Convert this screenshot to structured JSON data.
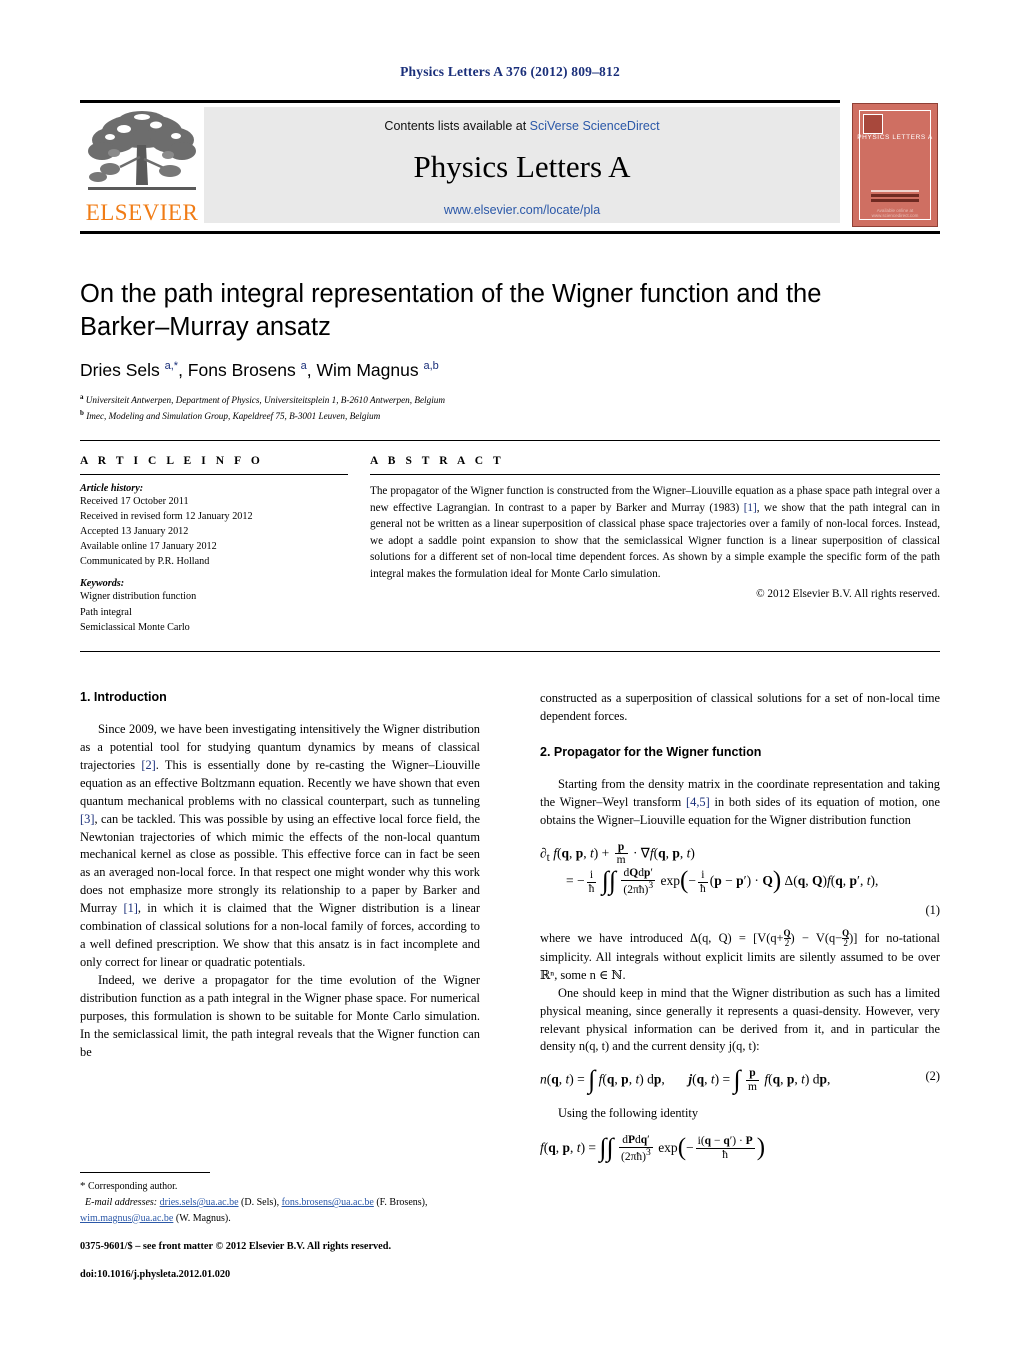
{
  "running_head": "Physics Letters A 376 (2012) 809–812",
  "masthead": {
    "contents_prefix": "Contents lists available at ",
    "contents_link": "SciVerse ScienceDirect",
    "journal_title": "Physics Letters A",
    "journal_url": "www.elsevier.com/locate/pla",
    "publisher_wordmark": "ELSEVIER",
    "cover_title": "PHYSICS LETTERS A",
    "cover_footer": "Available online at www.sciencedirect.com",
    "colors": {
      "link": "#2b58a8",
      "banner_bg": "#e9e9e9",
      "elsevier_orange": "#f07c16",
      "cover_red": "#cf6f62"
    }
  },
  "article": {
    "title": "On the path integral representation of the Wigner function and the Barker–Murray ansatz",
    "authors_html": "Dries Sels <sup>a,*</sup>, Fons Brosens <sup>a</sup>, Wim Magnus <sup>a,b</sup>",
    "affiliations": [
      {
        "marker": "a",
        "text": "Universiteit Antwerpen, Department of Physics, Universiteitsplein 1, B-2610 Antwerpen, Belgium"
      },
      {
        "marker": "b",
        "text": "Imec, Modeling and Simulation Group, Kapeldreef 75, B-3001 Leuven, Belgium"
      }
    ]
  },
  "article_info": {
    "heading": "A R T I C L E   I N F O",
    "history_label": "Article history:",
    "history": [
      "Received 17 October 2011",
      "Received in revised form 12 January 2012",
      "Accepted 13 January 2012",
      "Available online 17 January 2012",
      "Communicated by P.R. Holland"
    ],
    "keywords_label": "Keywords:",
    "keywords": [
      "Wigner distribution function",
      "Path integral",
      "Semiclassical Monte Carlo"
    ]
  },
  "abstract": {
    "heading": "A B S T R A C T",
    "part1": "The propagator of the Wigner function is constructed from the Wigner–Liouville equation as a phase space path integral over a new effective Lagrangian. In contrast to a paper by Barker and Murray (1983) ",
    "ref1": "[1]",
    "part2": ", we show that the path integral can in general not be written as a linear superposition of classical phase space trajectories over a family of non-local forces. Instead, we adopt a saddle point expansion to show that the semiclassical Wigner function is a linear superposition of classical solutions for a different set of non-local time dependent forces. As shown by a simple example the specific form of the path integral makes the formulation ideal for Monte Carlo simulation.",
    "copyright": "© 2012 Elsevier B.V. All rights reserved."
  },
  "sections": {
    "intro_heading": "1. Introduction",
    "intro_p1_a": "Since 2009, we have been investigating intensitively the Wigner distribution as a potential tool for studying quantum dynamics by means of classical trajectories ",
    "intro_p1_ref1": "[2]",
    "intro_p1_b": ". This is essentially done by re-casting the Wigner–Liouville equation as an effective Boltzmann equation. Recently we have shown that even quantum mechanical problems with no classical counterpart, such as tunneling ",
    "intro_p1_ref2": "[3]",
    "intro_p1_c": ", can be tackled. This was possible by using an effective local force field, the Newtonian trajectories of which mimic the effects of the non-local quantum mechanical kernel as close as possible. This effective force can in fact be seen as an averaged non-local force. In that respect one might wonder why this work does not emphasize more strongly its relationship to a paper by Barker and Murray ",
    "intro_p1_ref3": "[1]",
    "intro_p1_d": ", in which it is claimed that the Wigner distribution is a linear combination of classical solutions for a non-local family of forces, according to a well defined prescription. We show that this ansatz is in fact incomplete and only correct for linear or quadratic potentials.",
    "intro_p2": "Indeed, we derive a propagator for the time evolution of the Wigner distribution function as a path integral in the Wigner phase space. For numerical purposes, this formulation is shown to be suitable for Monte Carlo simulation. In the semiclassical limit, the path integral reveals that the Wigner function can be",
    "intro_p2_cont": "constructed as a superposition of classical solutions for a set of non-local time dependent forces.",
    "sec2_heading": "2. Propagator for the Wigner function",
    "sec2_p1_a": "Starting from the density matrix in the coordinate representation and taking the Wigner–Weyl transform ",
    "sec2_p1_ref": "[4,5]",
    "sec2_p1_b": " in both sides of its equation of motion, one obtains the Wigner–Liouville equation for the Wigner distribution function",
    "sec2_p2": "tational simplicity. All integrals without explicit limits are silently assumed to be over ℝⁿ, some n ∈ ℕ.",
    "sec2_p3": "One should keep in mind that the Wigner distribution as such has a limited physical meaning, since generally it represents a quasi-density. However, very relevant physical information can be derived from it, and in particular the density n(q, t) and the current density j(q, t):",
    "sec2_p4": "Using the following identity"
  },
  "equations": {
    "eq1_number": "(1)",
    "eq2_number": "(2)",
    "eq1_lhs": "∂ₜ f(q, p, t) + ",
    "where_intro": "where we have introduced Δ(q, Q) = [V(q+",
    "where_mid": ") − V(q−",
    "where_end": ")] for no-"
  },
  "footnote": {
    "corresponding": "Corresponding author.",
    "email_label": "E-mail addresses:",
    "emails": [
      {
        "address": "dries.sels@ua.ac.be",
        "owner": "(D. Sels)"
      },
      {
        "address": "fons.brosens@ua.ac.be",
        "owner": "(F. Brosens)"
      },
      {
        "address": "wim.magnus@ua.ac.be",
        "owner": "(W. Magnus)"
      }
    ],
    "issn_line": "0375-9601/$ – see front matter  © 2012 Elsevier B.V. All rights reserved.",
    "doi": "doi:10.1016/j.physleta.2012.01.020"
  }
}
